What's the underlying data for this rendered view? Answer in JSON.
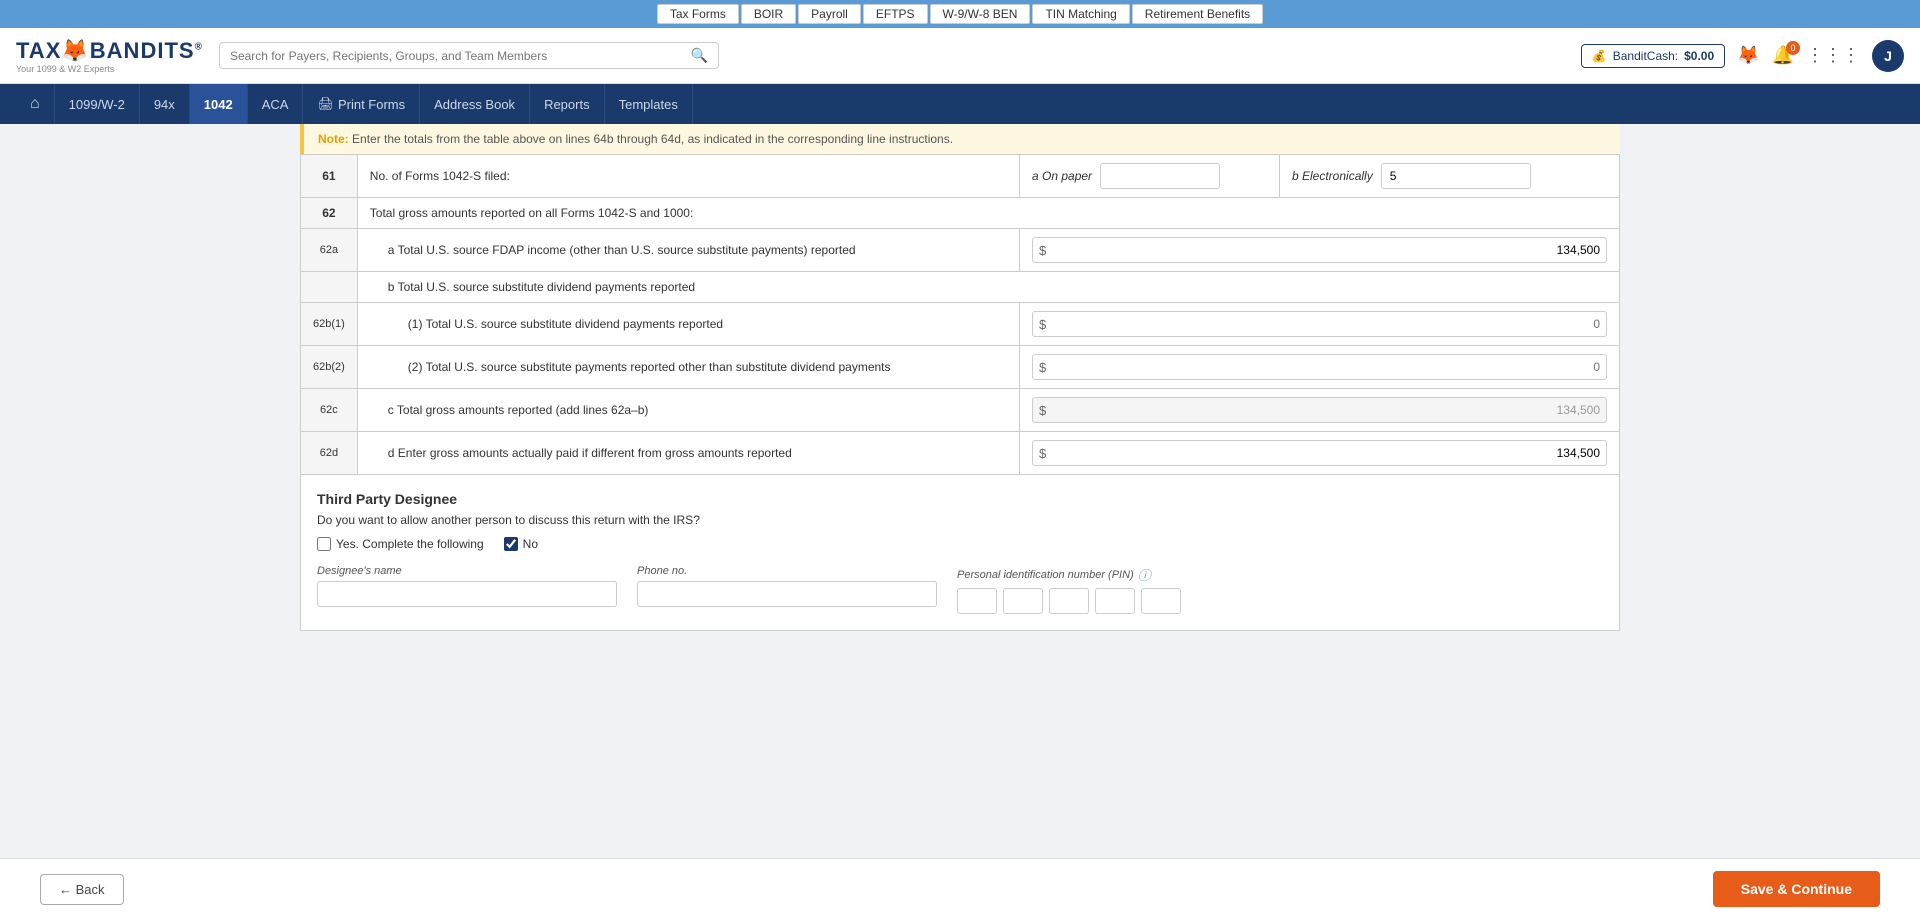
{
  "topnav": {
    "items": [
      {
        "id": "tax-forms",
        "label": "Tax Forms"
      },
      {
        "id": "boir",
        "label": "BOIR"
      },
      {
        "id": "payroll",
        "label": "Payroll"
      },
      {
        "id": "eftps",
        "label": "EFTPS"
      },
      {
        "id": "w9-w8-ben",
        "label": "W-9/W-8 BEN"
      },
      {
        "id": "tin-matching",
        "label": "TIN Matching"
      },
      {
        "id": "retirement-benefits",
        "label": "Retirement Benefits"
      }
    ]
  },
  "header": {
    "logo_main": "TAXBANDITS",
    "logo_highlight": "AND",
    "logo_sub": "Your 1099 & W2 Experts",
    "search_placeholder": "Search for Payers, Recipients, Groups, and Team Members",
    "bandit_cash_label": "BanditCash:",
    "bandit_cash_amount": "$0.00",
    "avatar_letter": "J",
    "notification_count": "0"
  },
  "secnav": {
    "items": [
      {
        "id": "home",
        "label": "⌂",
        "is_home": true
      },
      {
        "id": "1099-w2",
        "label": "1099/W-2"
      },
      {
        "id": "94x",
        "label": "94x"
      },
      {
        "id": "1042",
        "label": "1042",
        "active": true
      },
      {
        "id": "aca",
        "label": "ACA"
      },
      {
        "id": "print-forms",
        "label": "Print Forms",
        "has_icon": true
      },
      {
        "id": "address-book",
        "label": "Address Book"
      },
      {
        "id": "reports",
        "label": "Reports"
      },
      {
        "id": "templates",
        "label": "Templates"
      }
    ]
  },
  "note": {
    "prefix": "Note:",
    "text": "Enter the totals from the table above on lines 64b through 64d, as indicated in the corresponding line instructions."
  },
  "form": {
    "line61": {
      "num": "61",
      "label": "No. of Forms 1042-S filed:",
      "on_paper_label": "a  On paper",
      "on_paper_value": "",
      "electronically_label": "b  Electronically",
      "electronically_value": "5"
    },
    "line62": {
      "num": "62",
      "label": "Total gross amounts reported on all Forms 1042-S and 1000:"
    },
    "line62a": {
      "num": "62a",
      "label": "a   Total U.S. source FDAP income (other than U.S. source substitute payments) reported",
      "value": "134,500"
    },
    "line62b": {
      "num": "",
      "label": "b   Total U.S. source substitute dividend payments reported"
    },
    "line62b1": {
      "num": "62b(1)",
      "label": "(1)   Total U.S. source substitute dividend payments reported",
      "value": "0",
      "placeholder": "0"
    },
    "line62b2": {
      "num": "62b(2)",
      "label": "(2)   Total U.S. source substitute payments reported other than substitute dividend payments",
      "value": "0",
      "placeholder": "0"
    },
    "line62c": {
      "num": "62c",
      "label": "c   Total gross amounts reported (add lines 62a–b)",
      "value": "134,500",
      "readonly": true
    },
    "line62d": {
      "num": "62d",
      "label": "d   Enter gross amounts actually paid if different from gross amounts reported",
      "value": "134,500"
    }
  },
  "third_party": {
    "title": "Third Party Designee",
    "subtitle": "Do you want to allow another person to discuss this return with the IRS?",
    "yes_label": "Yes. Complete the following",
    "no_label": "No",
    "no_checked": true,
    "yes_checked": false,
    "designee_name_label": "Designee's name",
    "designee_name_value": "",
    "phone_label": "Phone no.",
    "phone_value": "",
    "pin_label": "Personal identification number (PIN)",
    "pin_fields": [
      "",
      "",
      "",
      "",
      ""
    ]
  },
  "bottom": {
    "back_label": "← Back",
    "save_label": "Save & Continue"
  }
}
